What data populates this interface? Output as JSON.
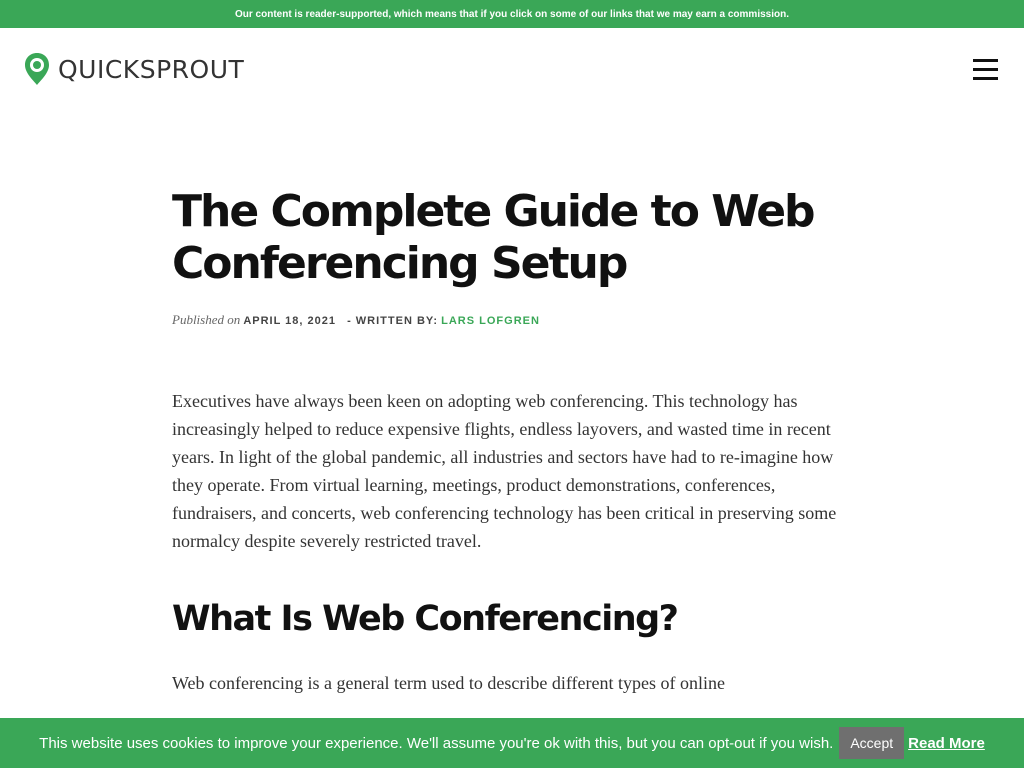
{
  "banner": {
    "text": "Our content is reader-supported, which means that if you click on some of our links that we may earn a commission."
  },
  "header": {
    "logo_text": "QUICKSPROUT",
    "brand_color": "#3aa757"
  },
  "article": {
    "title": "The Complete Guide to Web Conferencing Setup",
    "published_prefix": "Published on",
    "date": "APRIL 18, 2021",
    "written_by": "- WRITTEN BY:",
    "author": "LARS LOFGREN",
    "intro": "Executives have always been keen on adopting web conferencing. This technology has increasingly helped to reduce expensive flights, endless layovers, and wasted time in recent years. In light of the global pandemic, all industries and sectors have had to re-imagine how they operate. From virtual learning, meetings, product demonstrations, conferences, fundraisers, and concerts, web conferencing technology has been critical in preserving some normalcy despite severely restricted travel.",
    "section_heading": "What Is Web Conferencing?",
    "section_text": "Web conferencing is a general term used to describe different types of online"
  },
  "cookie": {
    "text": "This website uses cookies to improve your experience. We'll assume you're ok with this, but you can opt-out if you wish.",
    "accept_label": "Accept",
    "read_more_label": "Read More"
  },
  "icons": {
    "logo": "location-pin-icon",
    "menu": "hamburger-menu-icon"
  }
}
